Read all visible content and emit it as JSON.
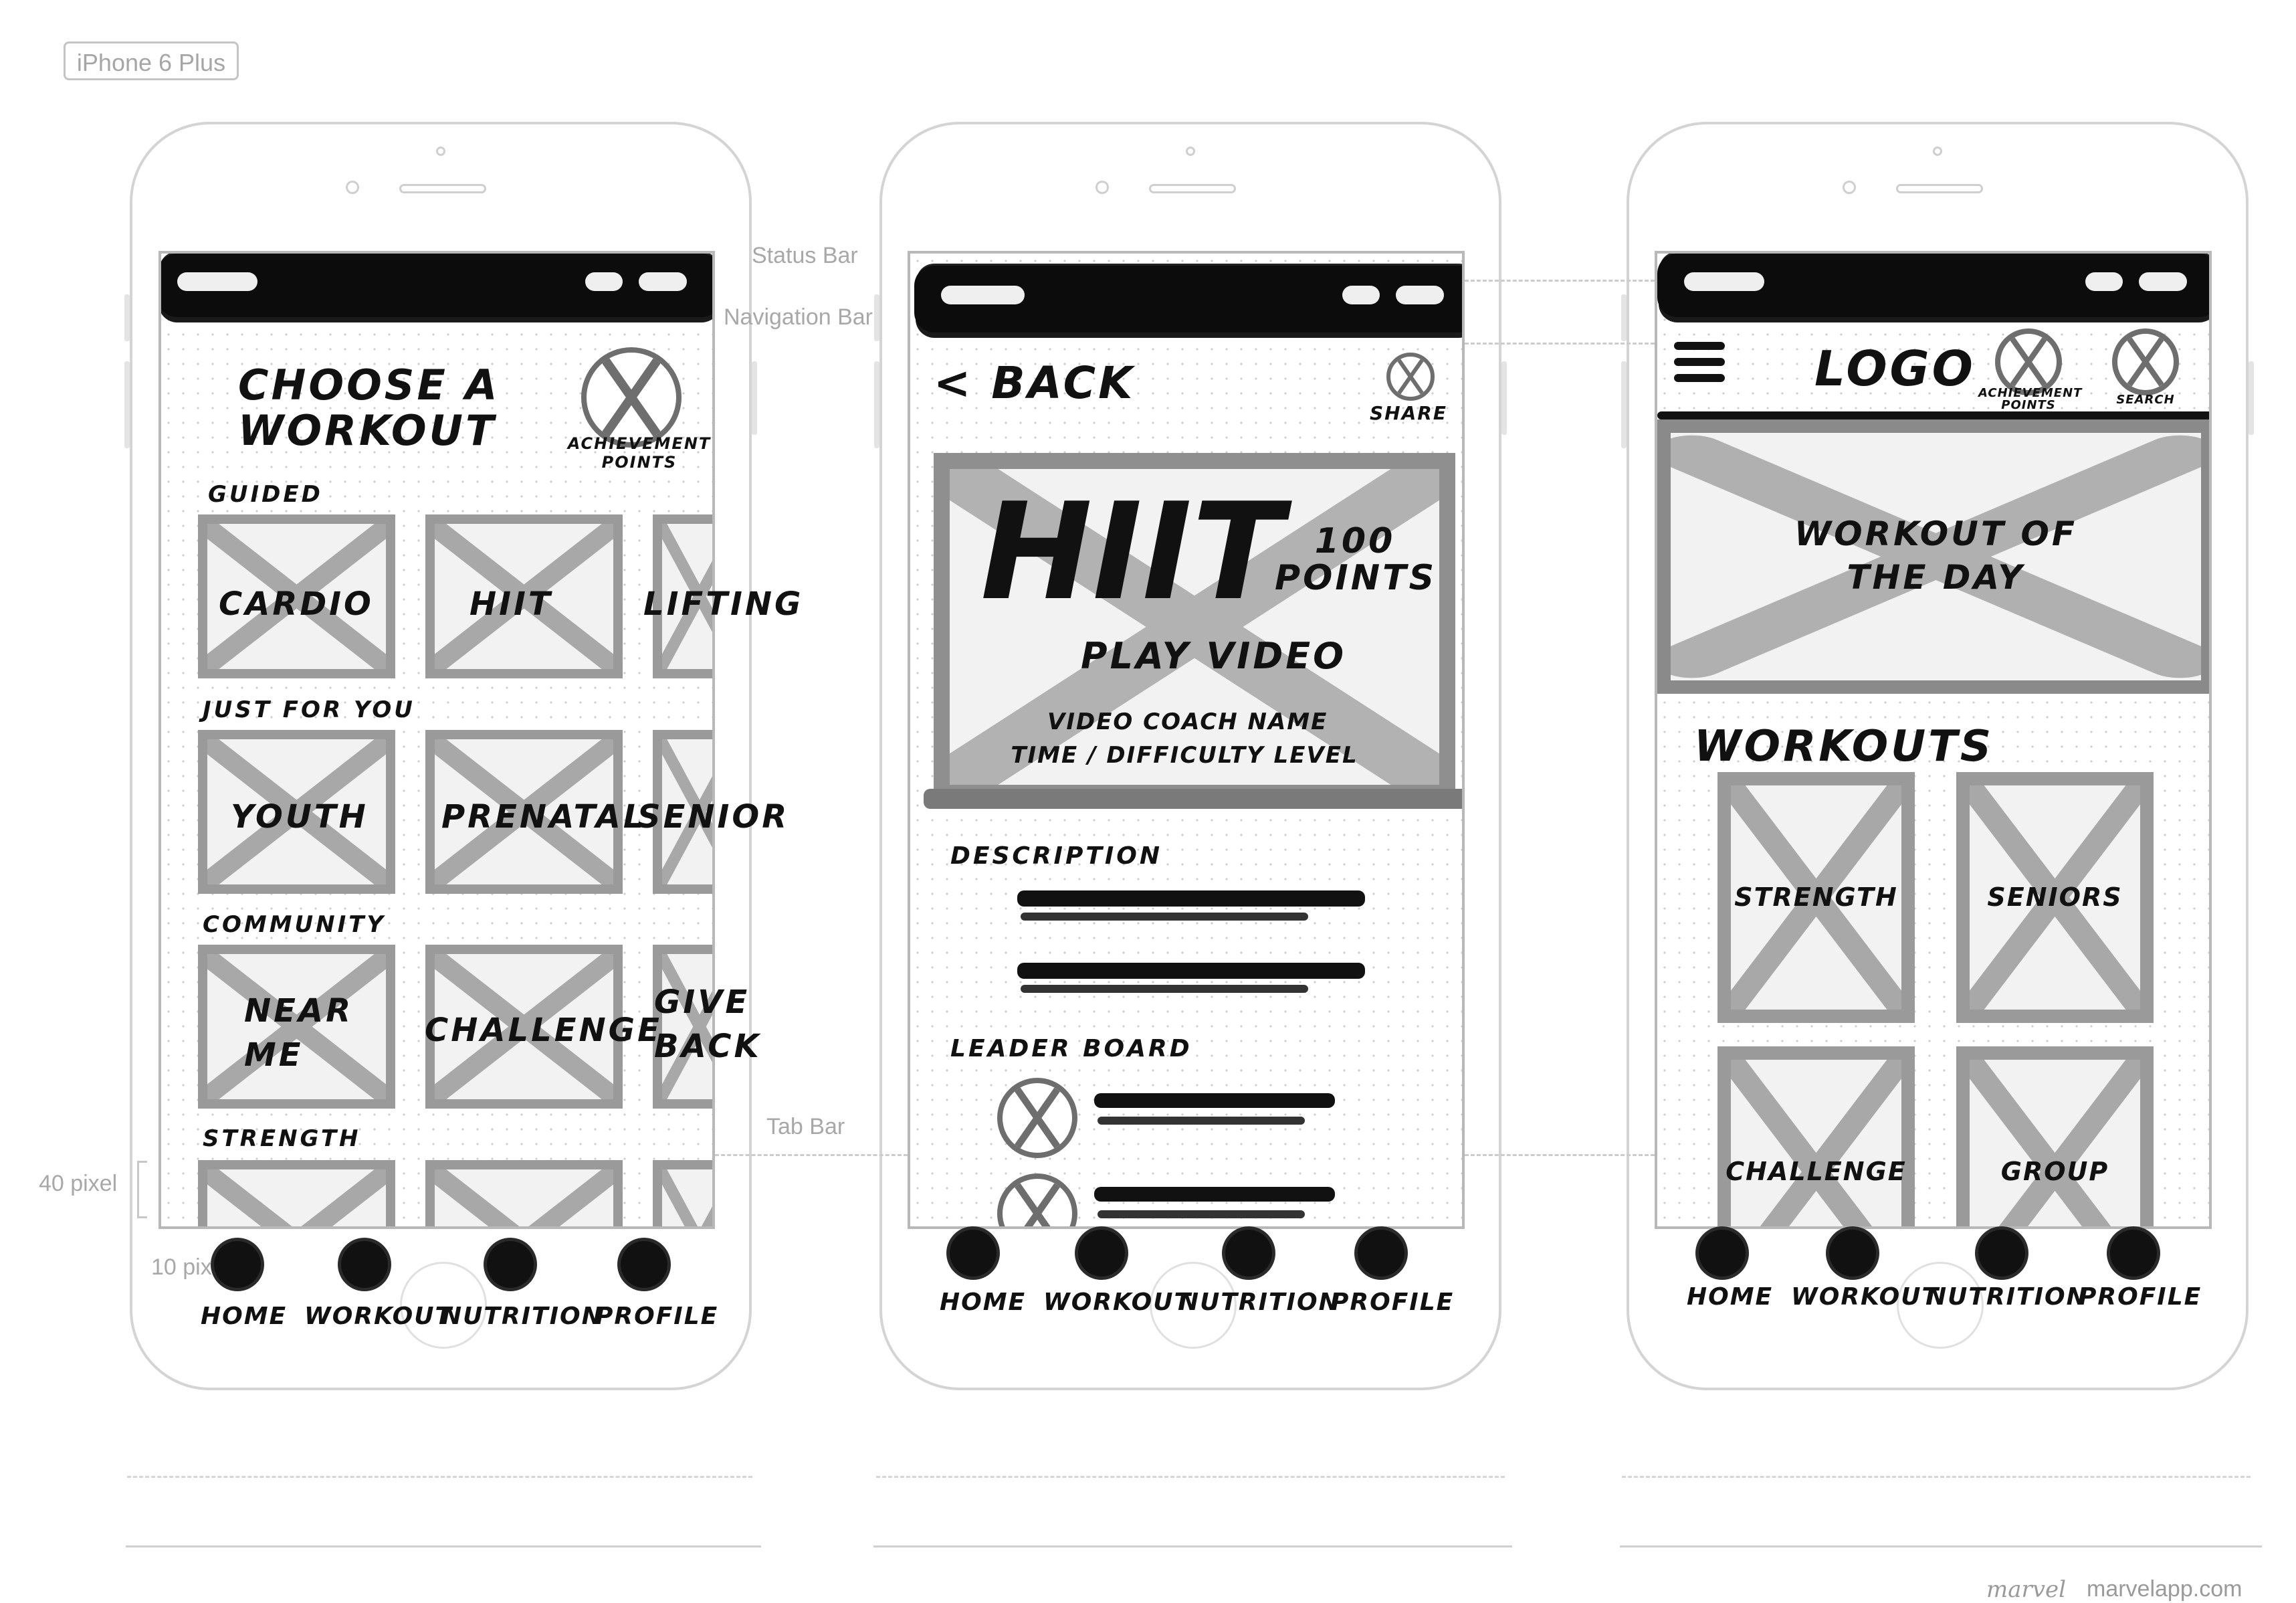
{
  "device": {
    "label": "iPhone 6 Plus"
  },
  "guides": {
    "status_bar": "Status Bar",
    "navigation_bar": "Navigation Bar",
    "tab_bar": "Tab Bar",
    "pixel_40": "40 pixel",
    "pixel_10": "10 pix"
  },
  "tabs": [
    "HOME",
    "WORKOUT",
    "NUTRITION",
    "PROFILE"
  ],
  "screen1": {
    "title_line1": "CHOOSE A",
    "title_line2": "WORKOUT",
    "achievement_line1": "ACHIEVEMENT",
    "achievement_line2": "POINTS",
    "sections": [
      {
        "heading": "GUIDED",
        "tiles": [
          "CARDIO",
          "HIIT",
          "LIFTING"
        ]
      },
      {
        "heading": "JUST FOR YOU",
        "tiles": [
          "YOUTH",
          "PRENATAL",
          "SENIOR"
        ]
      },
      {
        "heading": "COMMUNITY",
        "tiles": [
          "NEAR ME",
          "CHALLENGE",
          "GIVE BACK"
        ]
      },
      {
        "heading": "STRENGTH",
        "tiles": [
          "",
          "",
          ""
        ]
      }
    ]
  },
  "screen2": {
    "back": "< BACK",
    "share": "SHARE",
    "video_title": "HIIT",
    "points_line1": "100",
    "points_line2": "POINTS",
    "play": "PLAY VIDEO",
    "coach": "VIDEO COACH NAME",
    "time_level": "TIME / DIFFICULTY LEVEL",
    "description": "DESCRIPTION",
    "leaderboard": "LEADER BOARD"
  },
  "screen3": {
    "logo": "LOGO",
    "achievement_line1": "ACHIEVEMENT",
    "achievement_line2": "POINTS",
    "search": "SEARCH",
    "hero_line1": "WORKOUT OF",
    "hero_line2": "THE DAY",
    "workouts": "WORKOUTS",
    "tiles": [
      "STRENGTH",
      "SENIORS",
      "CHALLENGE",
      "GROUP"
    ]
  },
  "watermark": {
    "brand": "marvel",
    "site": "marvelapp.com"
  }
}
